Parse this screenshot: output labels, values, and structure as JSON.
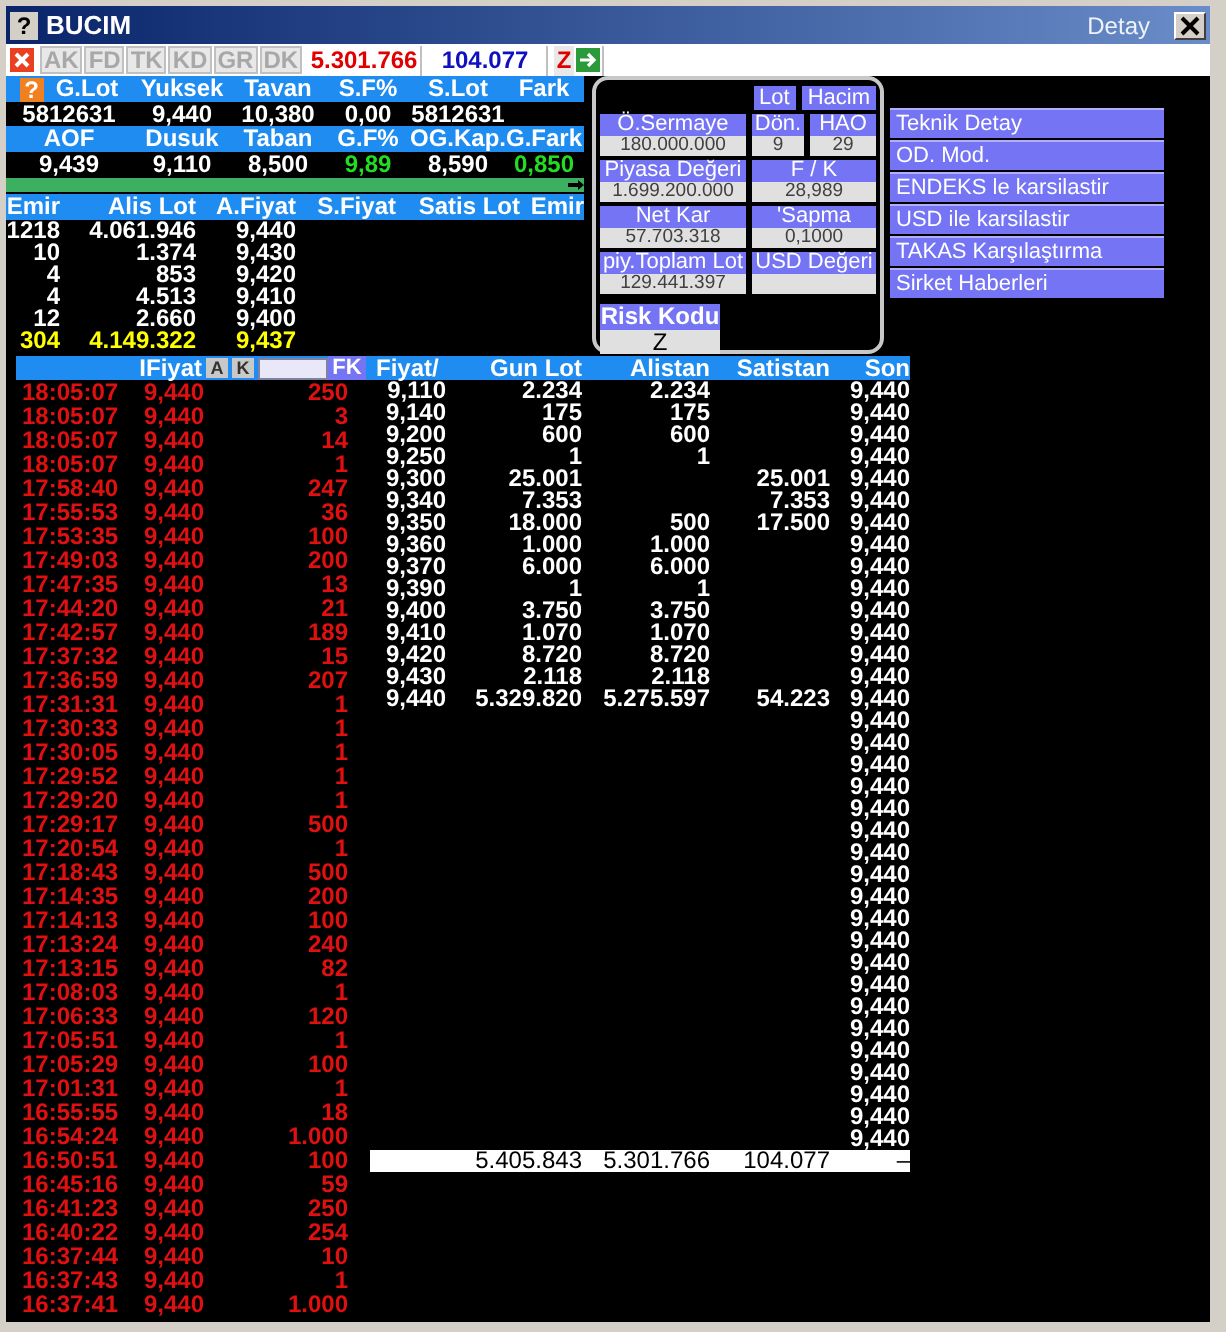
{
  "window": {
    "title": "BUCIM",
    "title_icon": "?",
    "caption": "Detay"
  },
  "toolbar": {
    "tabs": [
      {
        "label": "AK",
        "disabled": true
      },
      {
        "label": "FD",
        "disabled": true
      },
      {
        "label": "TK",
        "disabled": true
      },
      {
        "label": "KD",
        "disabled": true
      },
      {
        "label": "GR",
        "disabled": true
      },
      {
        "label": "DK",
        "disabled": true
      }
    ],
    "buy_volume": "5.301.766",
    "sell_volume": "104.077",
    "risk_code": "Z"
  },
  "summary": {
    "help": "?",
    "rows": [
      {
        "cells": [
          {
            "header": "G.Lot",
            "value": "5812631"
          },
          {
            "header": "Yuksek",
            "value": "9,440"
          },
          {
            "header": "Tavan",
            "value": "10,380"
          },
          {
            "header": "S.F%",
            "value": "0,00"
          },
          {
            "header": "S.Lot",
            "value": "5812631"
          },
          {
            "header": "Fark"
          }
        ]
      },
      {
        "cells": [
          {
            "header": "AOF",
            "value": "9,439"
          },
          {
            "header": "Dusuk",
            "value": "9,110"
          },
          {
            "header": "Taban",
            "value": "8,500"
          },
          {
            "header": "G.F%",
            "value": "9,89",
            "color": "#22dd22"
          },
          {
            "header": "OG.Kap.",
            "value": "8,590"
          },
          {
            "header": "G.Fark",
            "value": "0,850",
            "color": "#22dd22"
          }
        ]
      }
    ]
  },
  "depth": {
    "columns": [
      "Emir",
      "Alis Lot",
      "A.Fiyat",
      "S.Fiyat",
      "Satis Lot",
      "Emir"
    ],
    "rows": [
      {
        "kind": "level",
        "cells": [
          "1218",
          "4.061.946",
          "9,440"
        ]
      },
      {
        "kind": "level",
        "cells": [
          "10",
          "1.374",
          "9,430"
        ]
      },
      {
        "kind": "level",
        "cells": [
          "4",
          "853",
          "9,420"
        ]
      },
      {
        "kind": "level",
        "cells": [
          "4",
          "4.513",
          "9,410"
        ]
      },
      {
        "kind": "level",
        "cells": [
          "12",
          "2.660",
          "9,400"
        ]
      },
      {
        "kind": "total",
        "cells": [
          "304",
          "4.149.322",
          "9,437"
        ]
      }
    ]
  },
  "info_panel": {
    "buttons": [
      "Lot",
      "Hacim"
    ],
    "field_rows": [
      {
        "fields": [
          {
            "label": "Ö.Sermaye",
            "value": "180.000.000"
          },
          {
            "label": "Dön.",
            "value": "9"
          },
          {
            "label": "HAO",
            "value": "29"
          }
        ]
      },
      {
        "fields": [
          {
            "label": "Piyasa Değeri",
            "value": "1.699.200.000"
          },
          {
            "label": "F / K",
            "value": "28,989"
          }
        ]
      },
      {
        "fields": [
          {
            "label": "Net Kar",
            "value": "57.703.318"
          },
          {
            "label": "'Sapma",
            "value": "0,1000"
          }
        ]
      },
      {
        "fields": [
          {
            "label": "piy.Toplam Lot",
            "value": "129.441.397"
          },
          {
            "label": "USD Değeri"
          }
        ]
      }
    ],
    "risk": {
      "label": "Risk Kodu",
      "value": "Z"
    }
  },
  "links": [
    "Teknik Detay",
    "OD. Mod.",
    "ENDEKS le karsilastir",
    "USD ile karsilastir",
    "TAKAS Karşılaştırma",
    "Sirket Haberleri"
  ],
  "trades": {
    "header": "IFiyat",
    "buttons": [
      "A",
      "K"
    ],
    "filter_button": "FK",
    "rows": [
      {
        "time": "18:05:07",
        "price": "9,440",
        "lot": "250"
      },
      {
        "time": "18:05:07",
        "price": "9,440",
        "lot": "3"
      },
      {
        "time": "18:05:07",
        "price": "9,440",
        "lot": "14"
      },
      {
        "time": "18:05:07",
        "price": "9,440",
        "lot": "1"
      },
      {
        "time": "17:58:40",
        "price": "9,440",
        "lot": "247"
      },
      {
        "time": "17:55:53",
        "price": "9,440",
        "lot": "36"
      },
      {
        "time": "17:53:35",
        "price": "9,440",
        "lot": "100"
      },
      {
        "time": "17:49:03",
        "price": "9,440",
        "lot": "200"
      },
      {
        "time": "17:47:35",
        "price": "9,440",
        "lot": "13"
      },
      {
        "time": "17:44:20",
        "price": "9,440",
        "lot": "21"
      },
      {
        "time": "17:42:57",
        "price": "9,440",
        "lot": "189"
      },
      {
        "time": "17:37:32",
        "price": "9,440",
        "lot": "15"
      },
      {
        "time": "17:36:59",
        "price": "9,440",
        "lot": "207"
      },
      {
        "time": "17:31:31",
        "price": "9,440",
        "lot": "1"
      },
      {
        "time": "17:30:33",
        "price": "9,440",
        "lot": "1"
      },
      {
        "time": "17:30:05",
        "price": "9,440",
        "lot": "1"
      },
      {
        "time": "17:29:52",
        "price": "9,440",
        "lot": "1"
      },
      {
        "time": "17:29:20",
        "price": "9,440",
        "lot": "1"
      },
      {
        "time": "17:29:17",
        "price": "9,440",
        "lot": "500"
      },
      {
        "time": "17:20:54",
        "price": "9,440",
        "lot": "1"
      },
      {
        "time": "17:18:43",
        "price": "9,440",
        "lot": "500"
      },
      {
        "time": "17:14:35",
        "price": "9,440",
        "lot": "200"
      },
      {
        "time": "17:14:13",
        "price": "9,440",
        "lot": "100"
      },
      {
        "time": "17:13:24",
        "price": "9,440",
        "lot": "240"
      },
      {
        "time": "17:13:15",
        "price": "9,440",
        "lot": "82"
      },
      {
        "time": "17:08:03",
        "price": "9,440",
        "lot": "1"
      },
      {
        "time": "17:06:33",
        "price": "9,440",
        "lot": "120"
      },
      {
        "time": "17:05:51",
        "price": "9,440",
        "lot": "1"
      },
      {
        "time": "17:05:29",
        "price": "9,440",
        "lot": "100"
      },
      {
        "time": "17:01:31",
        "price": "9,440",
        "lot": "1"
      },
      {
        "time": "16:55:55",
        "price": "9,440",
        "lot": "18"
      },
      {
        "time": "16:54:24",
        "price": "9,440",
        "lot": "1.000"
      },
      {
        "time": "16:50:51",
        "price": "9,440",
        "lot": "100"
      },
      {
        "time": "16:45:16",
        "price": "9,440",
        "lot": "59"
      },
      {
        "time": "16:41:23",
        "price": "9,440",
        "lot": "250"
      },
      {
        "time": "16:40:22",
        "price": "9,440",
        "lot": "254"
      },
      {
        "time": "16:37:44",
        "price": "9,440",
        "lot": "10"
      },
      {
        "time": "16:37:43",
        "price": "9,440",
        "lot": "1"
      },
      {
        "time": "16:37:41",
        "price": "9,440",
        "lot": "1.000"
      }
    ]
  },
  "price_table": {
    "columns": [
      "Fiyat/",
      "Gun Lot",
      "Alistan",
      "Satistan",
      "Son"
    ],
    "rows": [
      {
        "fiyat": "9,110",
        "gun_lot": "2.234",
        "alistan": "2.234",
        "son": "9,440"
      },
      {
        "fiyat": "9,140",
        "gun_lot": "175",
        "alistan": "175",
        "son": "9,440"
      },
      {
        "fiyat": "9,200",
        "gun_lot": "600",
        "alistan": "600",
        "son": "9,440"
      },
      {
        "fiyat": "9,250",
        "gun_lot": "1",
        "alistan": "1",
        "son": "9,440"
      },
      {
        "fiyat": "9,300",
        "gun_lot": "25.001",
        "satistan": "25.001",
        "son": "9,440"
      },
      {
        "fiyat": "9,340",
        "gun_lot": "7.353",
        "satistan": "7.353",
        "son": "9,440"
      },
      {
        "fiyat": "9,350",
        "gun_lot": "18.000",
        "alistan": "500",
        "satistan": "17.500",
        "son": "9,440"
      },
      {
        "fiyat": "9,360",
        "gun_lot": "1.000",
        "alistan": "1.000",
        "son": "9,440"
      },
      {
        "fiyat": "9,370",
        "gun_lot": "6.000",
        "alistan": "6.000",
        "son": "9,440"
      },
      {
        "fiyat": "9,390",
        "gun_lot": "1",
        "alistan": "1",
        "son": "9,440"
      },
      {
        "fiyat": "9,400",
        "gun_lot": "3.750",
        "alistan": "3.750",
        "son": "9,440"
      },
      {
        "fiyat": "9,410",
        "gun_lot": "1.070",
        "alistan": "1.070",
        "son": "9,440"
      },
      {
        "fiyat": "9,420",
        "gun_lot": "8.720",
        "alistan": "8.720",
        "son": "9,440"
      },
      {
        "fiyat": "9,430",
        "gun_lot": "2.118",
        "alistan": "2.118",
        "son": "9,440"
      },
      {
        "fiyat": "9,440",
        "gun_lot": "5.329.820",
        "alistan": "5.275.597",
        "satistan": "54.223",
        "son": "9,440"
      },
      {
        "son": "9,440"
      },
      {
        "son": "9,440"
      },
      {
        "son": "9,440"
      },
      {
        "son": "9,440"
      },
      {
        "son": "9,440"
      },
      {
        "son": "9,440"
      },
      {
        "son": "9,440"
      },
      {
        "son": "9,440"
      },
      {
        "son": "9,440"
      },
      {
        "son": "9,440"
      },
      {
        "son": "9,440"
      },
      {
        "son": "9,440"
      },
      {
        "son": "9,440"
      },
      {
        "son": "9,440"
      },
      {
        "son": "9,440"
      },
      {
        "son": "9,440"
      },
      {
        "son": "9,440"
      },
      {
        "son": "9,440"
      },
      {
        "son": "9,440"
      },
      {
        "son": "9,440"
      }
    ],
    "totals": {
      "gun_lot": "5.405.843",
      "alistan": "5.301.766",
      "satistan": "104.077",
      "son": "–"
    }
  }
}
